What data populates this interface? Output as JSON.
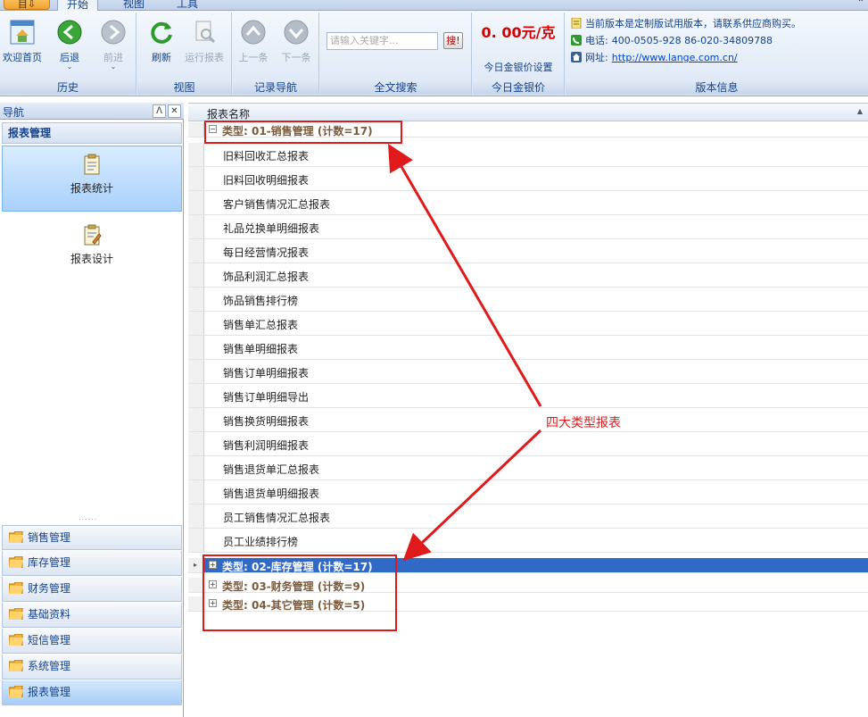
{
  "top_tabs": {
    "app_menu_label": "目⇩",
    "tabs": [
      "开始",
      "视图",
      "工具"
    ],
    "active_index": 0
  },
  "ribbon": {
    "groups": {
      "history": {
        "title": "历史",
        "buttons": [
          {
            "label": "欢迎首页",
            "icon": "home-icon",
            "enabled": true
          },
          {
            "label": "后退",
            "icon": "back-arrow-icon",
            "enabled": true
          },
          {
            "label": "前进",
            "icon": "forward-arrow-icon",
            "enabled": false
          }
        ]
      },
      "view": {
        "title": "视图",
        "buttons": [
          {
            "label": "刷新",
            "icon": "refresh-icon",
            "enabled": true
          },
          {
            "label": "运行报表",
            "icon": "run-report-icon",
            "enabled": false
          }
        ]
      },
      "record_nav": {
        "title": "记录导航",
        "buttons": [
          {
            "label": "上一条",
            "icon": "up-arrow-icon",
            "enabled": false
          },
          {
            "label": "下一条",
            "icon": "down-arrow-icon",
            "enabled": false
          }
        ]
      },
      "search": {
        "title": "全文搜索",
        "placeholder": "请输入关键字...",
        "button_label": "搜!"
      },
      "gold": {
        "title": "今日金银价",
        "price": "0. 00元/克",
        "setting_label": "今日金银价设置"
      },
      "version": {
        "title": "版本信息",
        "notice": "当前版本是定制版试用版本，请联系供应商购买。",
        "phone_label": "电话:",
        "phone_value": "400-0505-928  86-020-34809788",
        "site_label": "网址:",
        "site_value": "http://www.lange.com.cn/"
      }
    }
  },
  "nav": {
    "title": "导航",
    "section_title": "报表管理",
    "items": [
      {
        "label": "报表统计",
        "selected": true
      },
      {
        "label": "报表设计",
        "selected": false
      }
    ],
    "modules": [
      "销售管理",
      "库存管理",
      "财务管理",
      "基础资料",
      "短信管理",
      "系统管理",
      "报表管理"
    ],
    "active_module": "报表管理"
  },
  "grid": {
    "column_header": "报表名称",
    "groups": [
      {
        "label": "类型: 01-销售管理 (计数=17)",
        "expanded": true,
        "rows": [
          "旧料回收汇总报表",
          "旧料回收明细报表",
          "客户销售情况汇总报表",
          "礼品兑换单明细报表",
          "每日经营情况报表",
          "饰品利润汇总报表",
          "饰品销售排行榜",
          "销售单汇总报表",
          "销售单明细报表",
          "销售订单明细报表",
          "销售订单明细导出",
          "销售换货明细报表",
          "销售利润明细报表",
          "销售退货单汇总报表",
          "销售退货单明细报表",
          "员工销售情况汇总报表",
          "员工业绩排行榜"
        ]
      },
      {
        "label": "类型: 02-库存管理 (计数=17)",
        "expanded": false,
        "selected": true
      },
      {
        "label": "类型: 03-财务管理 (计数=9)",
        "expanded": false
      },
      {
        "label": "类型: 04-其它管理 (计数=5)",
        "expanded": false
      }
    ]
  },
  "annotation": {
    "text": "四大类型报表",
    "color": "#e0191a"
  }
}
